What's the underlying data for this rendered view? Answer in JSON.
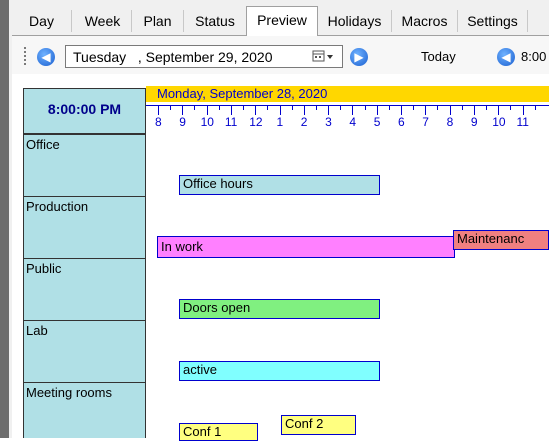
{
  "tabs": [
    {
      "label": "Day"
    },
    {
      "label": "Week"
    },
    {
      "label": "Plan"
    },
    {
      "label": "Status"
    },
    {
      "label": "Preview"
    },
    {
      "label": "Holidays"
    },
    {
      "label": "Macros"
    },
    {
      "label": "Settings"
    }
  ],
  "toolbar": {
    "date_value": "Tuesday   , September 29, 2020",
    "today_label": "Today",
    "time_truncated": "8:00"
  },
  "scheduler": {
    "current_time": "8:00:00 PM",
    "date_header": "Monday, September 28, 2020",
    "hours": [
      "8",
      "9",
      "10",
      "11",
      "12",
      "1",
      "2",
      "3",
      "4",
      "5",
      "6",
      "7",
      "8",
      "9",
      "10",
      "11"
    ],
    "resources": [
      {
        "label": "Office"
      },
      {
        "label": "Production"
      },
      {
        "label": "Public"
      },
      {
        "label": "Lab"
      },
      {
        "label": "Meeting rooms"
      }
    ],
    "appointments": [
      {
        "label": "Office hours",
        "color": "#b0e0e6"
      },
      {
        "label": "In work",
        "color": "#ff80ff"
      },
      {
        "label": "Maintenanc",
        "color": "#f08080"
      },
      {
        "label": "Doors open",
        "color": "#80f080"
      },
      {
        "label": "active",
        "color": "#80ffff"
      },
      {
        "label": "Conf 1",
        "color": "#ffff80"
      },
      {
        "label": "Conf 2",
        "color": "#ffff80"
      }
    ]
  },
  "colors": {
    "resource_bg": "#b0e0e6",
    "date_strip": "#ffd700",
    "accent": "#0000cd"
  }
}
